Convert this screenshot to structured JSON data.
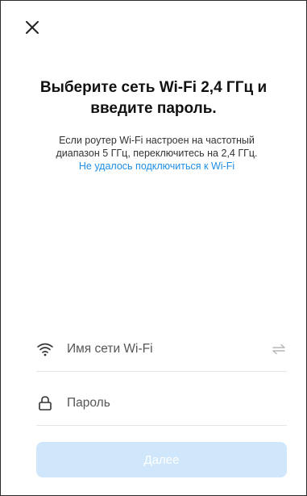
{
  "header": {
    "close_icon": "close-icon"
  },
  "content": {
    "title": "Выберите сеть Wi-Fi 2,4 ГГц и введите пароль.",
    "description_line1": "Если роутер Wi-Fi настроен на частотный",
    "description_line2": "диапазон 5 ГГц, переключитесь на 2,4 ГГц.",
    "help_link": "Не удалось подключиться к Wi-Fi"
  },
  "form": {
    "wifi_placeholder": "Имя сети Wi-Fi",
    "wifi_icon": "wifi-icon",
    "switch_icon": "swap-arrows-icon",
    "password_placeholder": "Пароль",
    "password_icon": "lock-icon"
  },
  "actions": {
    "next_label": "Далее"
  },
  "colors": {
    "link": "#1f8ee6",
    "button_disabled": "#cfe6fb"
  }
}
